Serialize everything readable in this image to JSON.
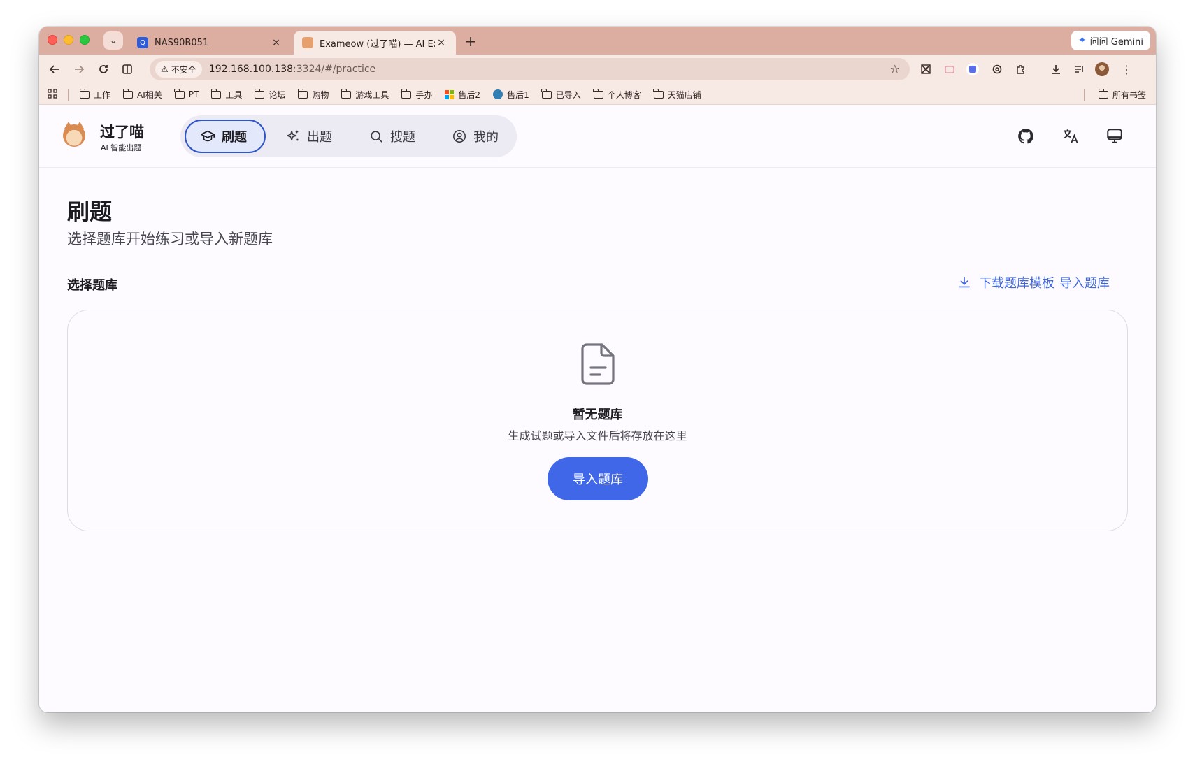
{
  "browser": {
    "tabs": [
      {
        "title": "NAS90B051",
        "close": "×",
        "favicon": "qnap-icon"
      },
      {
        "title": "Exameow (过了喵) — AI Exam",
        "close": "×",
        "favicon": "cat-icon",
        "active": true
      }
    ],
    "new_tab": "+",
    "gemini_label": "问问 Gemini",
    "security_label": "不安全",
    "url_host": "192.168.100.138",
    "url_rest": ":3324/#/practice",
    "bookmarks": [
      {
        "label": "工作",
        "type": "folder"
      },
      {
        "label": "AI相关",
        "type": "folder"
      },
      {
        "label": "PT",
        "type": "folder"
      },
      {
        "label": "工具",
        "type": "folder"
      },
      {
        "label": "论坛",
        "type": "folder"
      },
      {
        "label": "购物",
        "type": "folder"
      },
      {
        "label": "游戏工具",
        "type": "folder"
      },
      {
        "label": "手办",
        "type": "folder"
      },
      {
        "label": "售后2",
        "type": "ms"
      },
      {
        "label": "售后1",
        "type": "s1"
      },
      {
        "label": "已导入",
        "type": "folder"
      },
      {
        "label": "个人博客",
        "type": "folder"
      },
      {
        "label": "天猫店铺",
        "type": "folder"
      }
    ],
    "all_bookmarks": "所有书签"
  },
  "app": {
    "brand_title": "过了喵",
    "brand_subtitle": "AI 智能出题",
    "nav": [
      {
        "label": "刷题",
        "icon": "graduation-cap-icon",
        "active": true
      },
      {
        "label": "出题",
        "icon": "sparkles-icon"
      },
      {
        "label": "搜题",
        "icon": "search-icon"
      },
      {
        "label": "我的",
        "icon": "user-circle-icon"
      }
    ],
    "header_icons": [
      "github-icon",
      "translate-icon",
      "monitor-icon"
    ]
  },
  "page": {
    "title": "刷题",
    "subtitle": "选择题库开始练习或导入新题库",
    "section_label": "选择题库",
    "download_template": "下载题库模板",
    "import_link": "导入题库",
    "empty_title": "暂无题库",
    "empty_subtitle": "生成试题或导入文件后将存放在这里",
    "empty_button": "导入题库"
  },
  "colors": {
    "tabbar": "#dcaea1",
    "toolbar": "#f7e9e4",
    "accent": "#3f67e8",
    "link": "#3f67d8",
    "nav_active_border": "#2e56c8"
  }
}
